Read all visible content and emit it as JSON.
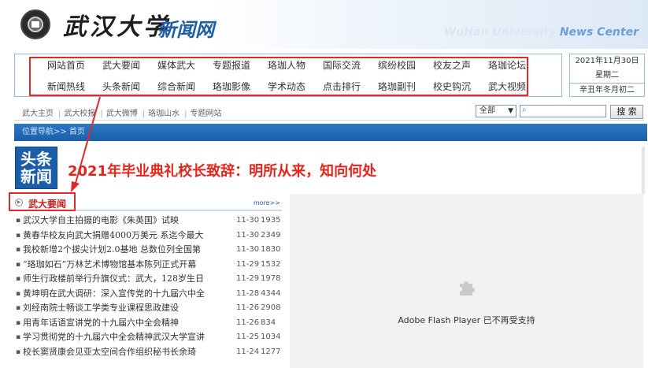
{
  "header": {
    "logo_text": "武汉大学",
    "site_name": "新闻网",
    "english_title_faded": "WuHan University",
    "english_title_strong": "News Center"
  },
  "nav": {
    "row1": [
      "网站首页",
      "武大要闻",
      "媒体武大",
      "专题报道",
      "珞珈人物",
      "国际交流",
      "缤纷校园",
      "校友之声",
      "珞珈论坛"
    ],
    "row2": [
      "新闻热线",
      "头条新闻",
      "综合新闻",
      "珞珈影像",
      "学术动态",
      "点击排行",
      "珞珈副刊",
      "校史钩沉",
      "武大视频"
    ]
  },
  "date": {
    "date": "2021年11月30日",
    "weekday": "星期二",
    "lunar": "辛丑年冬月初二"
  },
  "subnav": {
    "links": [
      "武大主页",
      "武大校报",
      "武大微博",
      "珞珈山水",
      "专题网站"
    ],
    "scope_value": "全部",
    "search_button": "搜 索"
  },
  "breadcrumb": "位置导航>> 首页",
  "headline": {
    "badge_line1": "头条",
    "badge_line2": "新闻",
    "title": "2021年毕业典礼校长致辞：明所从来，知向何处"
  },
  "news_section": {
    "title": "武大要闻",
    "more": "more>>",
    "items": [
      {
        "title": "武汉大学自主拍摄的电影《朱英国》试映",
        "date": "11-30",
        "views": "1935"
      },
      {
        "title": "黄春华校友向武大捐赠4000万美元 系迄今最大",
        "date": "11-30",
        "views": "2349"
      },
      {
        "title": "我校新增2个拔尖计划2.0基地 总数位列全国第",
        "date": "11-30",
        "views": "1830"
      },
      {
        "title": "“珞珈如石”万林艺术博物馆基本陈列正式开幕",
        "date": "11-29",
        "views": "1532"
      },
      {
        "title": "师生行政楼前举行升旗仪式：武大，128岁生日",
        "date": "11-29",
        "views": "1978"
      },
      {
        "title": "黄坤明在武大调研：深入宣传党的十九届六中全",
        "date": "11-28",
        "views": "4344"
      },
      {
        "title": "刘经南院士畅谈工学类专业课程思政建设",
        "date": "11-26",
        "views": "2908"
      },
      {
        "title": "用青年话语宣讲党的十九届六中全会精神",
        "date": "11-26",
        "views": "834"
      },
      {
        "title": "学习贯彻党的十九届六中全会精神武汉大学宣讲",
        "date": "11-25",
        "views": "1034"
      },
      {
        "title": "校长窦贤康会见亚太空间合作组织秘书长余琦",
        "date": "11-24",
        "views": "1277"
      }
    ]
  },
  "flash": {
    "message": "Adobe Flash Player 已不再受支持",
    "icon": "puzzle-plugin-icon"
  },
  "colors": {
    "brand_blue": "#1a5ea7",
    "headline_red": "#e3261b",
    "annotation_red": "#e02a2a"
  }
}
